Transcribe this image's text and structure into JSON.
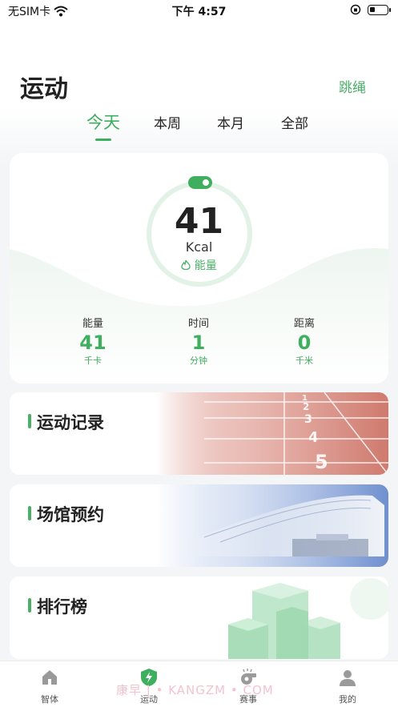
{
  "status_bar": {
    "carrier": "无SIM卡",
    "time": "下午 4:57"
  },
  "header": {
    "title": "运动",
    "action": "跳绳"
  },
  "tabs": [
    {
      "label": "今天",
      "active": true
    },
    {
      "label": "本周",
      "active": false
    },
    {
      "label": "本月",
      "active": false
    },
    {
      "label": "全部",
      "active": false
    }
  ],
  "energy": {
    "value": "41",
    "unit": "Kcal",
    "label": "能量",
    "ring_progress": 0.0
  },
  "stats": [
    {
      "label": "能量",
      "value": "41",
      "unit": "千卡"
    },
    {
      "label": "时间",
      "value": "1",
      "unit": "分钟"
    },
    {
      "label": "距离",
      "value": "0",
      "unit": "千米"
    }
  ],
  "menu": [
    {
      "title": "运动记录",
      "art": "running-track"
    },
    {
      "title": "场馆预约",
      "art": "stadium"
    },
    {
      "title": "排行榜",
      "art": "green-blocks"
    }
  ],
  "tabbar": [
    {
      "label": "智体",
      "icon": "home-icon",
      "active": false
    },
    {
      "label": "运动",
      "icon": "shield-bolt-icon",
      "active": true
    },
    {
      "label": "赛事",
      "icon": "whistle-icon",
      "active": false
    },
    {
      "label": "我的",
      "icon": "user-icon",
      "active": false
    }
  ],
  "watermark": "康早 | • KANGZM • COM",
  "colors": {
    "accent": "#3fae5f",
    "accent_light": "#e6f4ea",
    "track": "#d98a7e"
  }
}
